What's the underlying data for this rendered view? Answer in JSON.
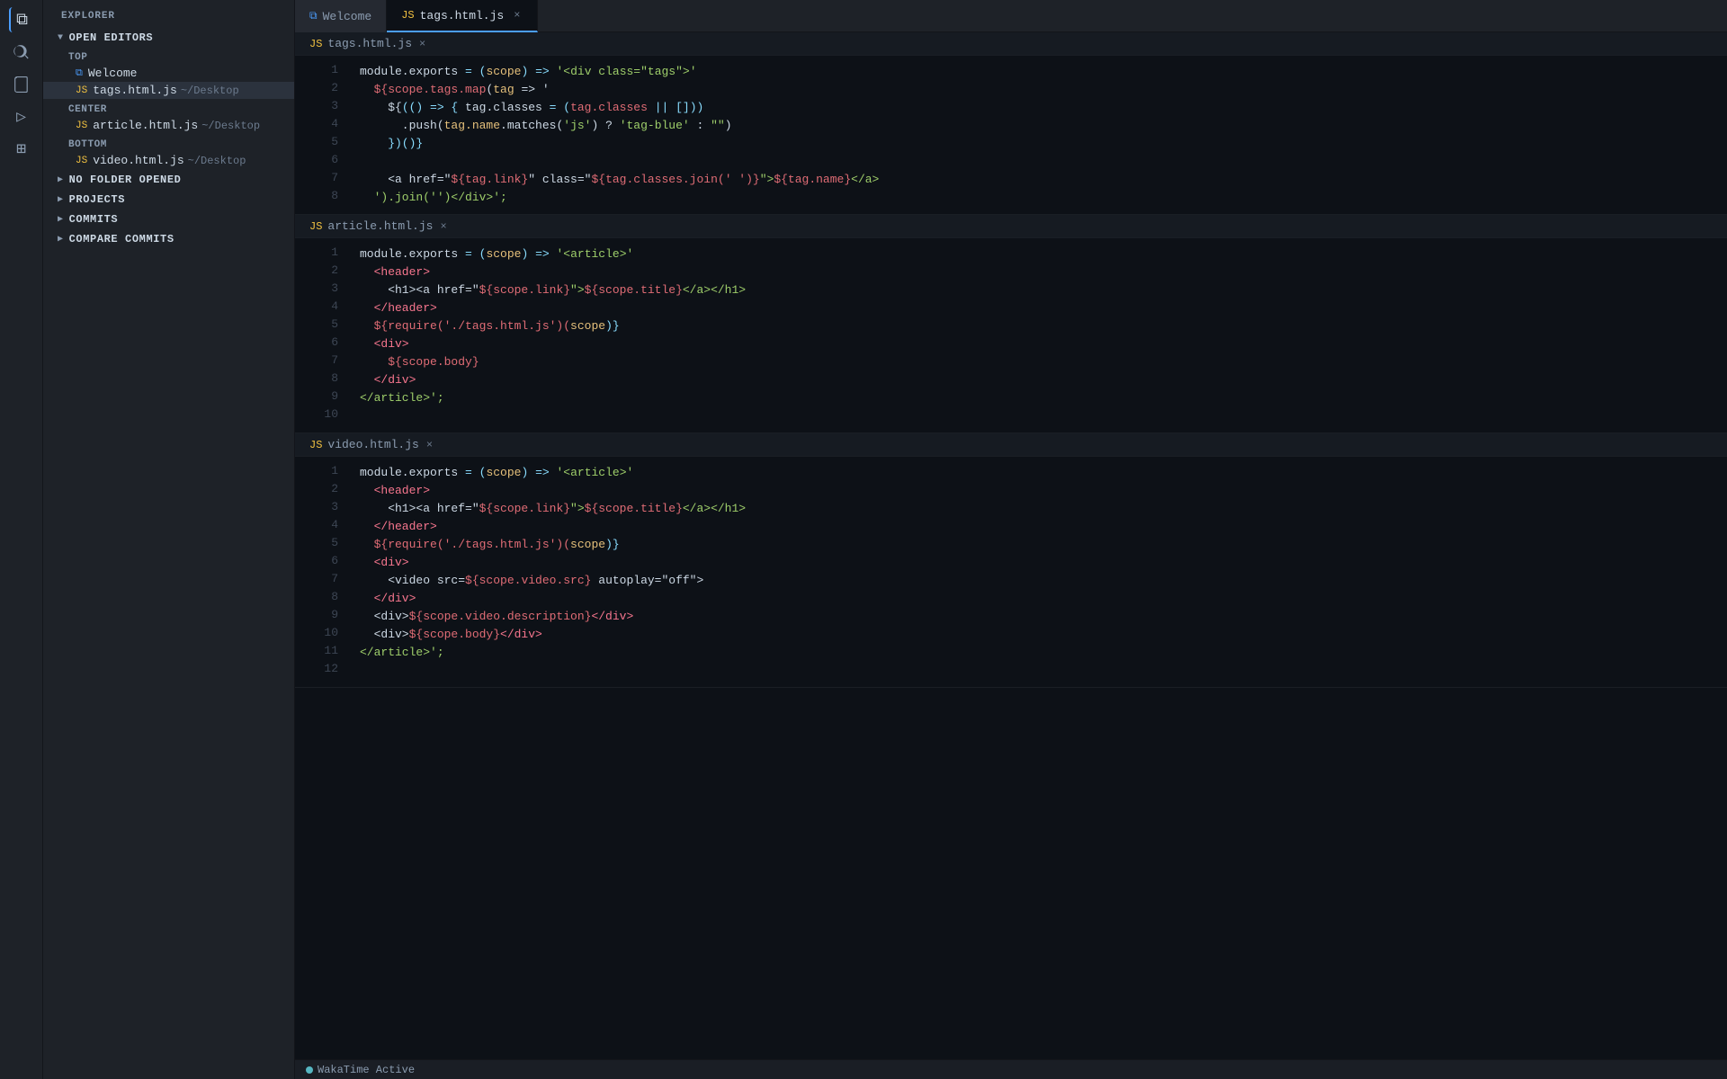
{
  "activityBar": {
    "icons": [
      {
        "name": "files-icon",
        "symbol": "⧉",
        "active": true
      },
      {
        "name": "search-icon",
        "symbol": "🔍"
      },
      {
        "name": "source-control-icon",
        "symbol": "⎇"
      },
      {
        "name": "debug-icon",
        "symbol": "▷"
      },
      {
        "name": "extensions-icon",
        "symbol": "⊞"
      }
    ]
  },
  "sidebar": {
    "title": "EXPLORER",
    "sections": [
      {
        "id": "open-editors",
        "label": "OPEN EDITORS",
        "expanded": true,
        "groups": [
          {
            "label": "TOP",
            "files": [
              {
                "icon": "vscode",
                "color": "blue",
                "name": "Welcome",
                "path": ""
              },
              {
                "icon": "js",
                "color": "js",
                "name": "tags.html.js",
                "path": "~/Desktop",
                "active": true
              }
            ]
          },
          {
            "label": "CENTER",
            "files": [
              {
                "icon": "js",
                "color": "js",
                "name": "article.html.js",
                "path": "~/Desktop"
              }
            ]
          },
          {
            "label": "BOTTOM",
            "files": [
              {
                "icon": "js",
                "color": "js",
                "name": "video.html.js",
                "path": "~/Desktop"
              }
            ]
          }
        ]
      },
      {
        "id": "no-folder",
        "label": "NO FOLDER OPENED",
        "expanded": false
      },
      {
        "id": "projects",
        "label": "PROJECTS",
        "expanded": false
      },
      {
        "id": "commits",
        "label": "COMMITS",
        "expanded": false
      },
      {
        "id": "compare-commits",
        "label": "COMPARE COMMiTS",
        "expanded": false
      }
    ]
  },
  "tabs": [
    {
      "label": "Welcome",
      "icon": "vscode",
      "active": false,
      "closable": false
    },
    {
      "label": "tags.html.js",
      "icon": "js",
      "active": true,
      "closable": true
    }
  ],
  "editors": [
    {
      "id": "tags-html-js",
      "filename": "tags.html.js",
      "icon": "JS",
      "lines": [
        {
          "num": 1,
          "tokens": [
            {
              "t": "plain",
              "v": "module.exports = "
            },
            {
              "t": "punc",
              "v": "("
            },
            {
              "t": "param",
              "v": "scope"
            },
            {
              "t": "punc",
              "v": ")"
            },
            {
              "t": "plain",
              "v": " "
            },
            {
              "t": "punc",
              "v": "=>"
            },
            {
              "t": "str",
              "v": " '<div class=\"tags\">'"
            }
          ]
        },
        {
          "num": 2,
          "tokens": [
            {
              "t": "tmpl",
              "v": "  ${scope.tags.map"
            },
            {
              "t": "plain",
              "v": "("
            },
            {
              "t": "param",
              "v": "tag"
            },
            {
              "t": "plain",
              "v": " => '"
            }
          ]
        },
        {
          "num": 3,
          "tokens": [
            {
              "t": "plain",
              "v": "    ${"
            },
            {
              "t": "punc",
              "v": "(() => {"
            },
            {
              "t": "plain",
              "v": " tag.classes = "
            },
            {
              "t": "punc",
              "v": "("
            },
            {
              "t": "red",
              "v": "tag.classes"
            },
            {
              "t": "punc",
              "v": " || "
            },
            {
              "t": "punc",
              "v": "[]"
            },
            {
              "t": "punc",
              "v": ")"
            },
            {
              "t": "punc",
              "v": ")"
            }
          ]
        },
        {
          "num": 4,
          "tokens": [
            {
              "t": "plain",
              "v": "      .push("
            },
            {
              "t": "param",
              "v": "tag.name"
            },
            {
              "t": "plain",
              "v": ".matches("
            },
            {
              "t": "str",
              "v": "'js'"
            },
            {
              "t": "plain",
              "v": ") ? "
            },
            {
              "t": "str",
              "v": "'tag-blue'"
            },
            {
              "t": "plain",
              "v": " : "
            },
            {
              "t": "str",
              "v": "\"\""
            }
          ]
        },
        {
          "num": 5,
          "tokens": [
            {
              "t": "punc",
              "v": "    })()"
            },
            {
              "t": "punc",
              "v": "}"
            }
          ]
        },
        {
          "num": 6,
          "tokens": []
        },
        {
          "num": 7,
          "tokens": [
            {
              "t": "plain",
              "v": "    <a href=\""
            },
            {
              "t": "tmpl",
              "v": "${tag.link}"
            },
            {
              "t": "plain",
              "v": "\" class=\""
            },
            {
              "t": "tmpl",
              "v": "${tag.classes.join(' ')}"
            },
            {
              "t": "str",
              "v": "\">"
            },
            {
              "t": "tmpl",
              "v": "${tag.name}"
            },
            {
              "t": "str",
              "v": "</a>"
            }
          ]
        },
        {
          "num": 8,
          "tokens": [
            {
              "t": "str",
              "v": "  ').join('')</div>';"
            }
          ]
        }
      ]
    },
    {
      "id": "article-html-js",
      "filename": "article.html.js",
      "icon": "JS",
      "lines": [
        {
          "num": 1,
          "tokens": [
            {
              "t": "plain",
              "v": "module.exports = "
            },
            {
              "t": "punc",
              "v": "("
            },
            {
              "t": "param",
              "v": "scope"
            },
            {
              "t": "punc",
              "v": ")"
            },
            {
              "t": "plain",
              "v": " "
            },
            {
              "t": "punc",
              "v": "=>"
            },
            {
              "t": "str",
              "v": " '<article>'"
            }
          ]
        },
        {
          "num": 2,
          "tokens": [
            {
              "t": "tag-c",
              "v": "  <header>"
            }
          ]
        },
        {
          "num": 3,
          "tokens": [
            {
              "t": "plain",
              "v": "    <h1><a href=\""
            },
            {
              "t": "tmpl",
              "v": "${scope.link}"
            },
            {
              "t": "str",
              "v": "\">"
            },
            {
              "t": "tmpl",
              "v": "${scope.title}"
            },
            {
              "t": "str",
              "v": "</a></h1>"
            }
          ]
        },
        {
          "num": 4,
          "tokens": [
            {
              "t": "tag-c",
              "v": "  </header>"
            }
          ]
        },
        {
          "num": 5,
          "tokens": [
            {
              "t": "tmpl",
              "v": "  ${require('./tags.html.js')"
            },
            {
              "t": "punc",
              "v": "("
            },
            {
              "t": "param",
              "v": "scope"
            },
            {
              "t": "punc",
              "v": ")"
            },
            {
              "t": "punc",
              "v": "}"
            }
          ]
        },
        {
          "num": 6,
          "tokens": [
            {
              "t": "tag-c",
              "v": "  <div>"
            }
          ]
        },
        {
          "num": 7,
          "tokens": [
            {
              "t": "tmpl",
              "v": "    ${scope.body}"
            }
          ]
        },
        {
          "num": 8,
          "tokens": [
            {
              "t": "tag-c",
              "v": "  </div>"
            }
          ]
        },
        {
          "num": 9,
          "tokens": [
            {
              "t": "str",
              "v": "</article>';"
            }
          ]
        },
        {
          "num": 10,
          "tokens": []
        }
      ]
    },
    {
      "id": "video-html-js",
      "filename": "video.html.js",
      "icon": "JS",
      "lines": [
        {
          "num": 1,
          "tokens": [
            {
              "t": "plain",
              "v": "module.exports = "
            },
            {
              "t": "punc",
              "v": "("
            },
            {
              "t": "param",
              "v": "scope"
            },
            {
              "t": "punc",
              "v": ")"
            },
            {
              "t": "plain",
              "v": " "
            },
            {
              "t": "punc",
              "v": "=>"
            },
            {
              "t": "str",
              "v": " '<article>'"
            }
          ]
        },
        {
          "num": 2,
          "tokens": [
            {
              "t": "tag-c",
              "v": "  <header>"
            }
          ]
        },
        {
          "num": 3,
          "tokens": [
            {
              "t": "plain",
              "v": "    <h1><a href=\""
            },
            {
              "t": "tmpl",
              "v": "${scope.link}"
            },
            {
              "t": "str",
              "v": "\">"
            },
            {
              "t": "tmpl",
              "v": "${scope.title}"
            },
            {
              "t": "str",
              "v": "</a></h1>"
            }
          ]
        },
        {
          "num": 4,
          "tokens": [
            {
              "t": "tag-c",
              "v": "  </header>"
            }
          ]
        },
        {
          "num": 5,
          "tokens": [
            {
              "t": "tmpl",
              "v": "  ${require('./tags.html.js')"
            },
            {
              "t": "punc",
              "v": "("
            },
            {
              "t": "param",
              "v": "scope"
            },
            {
              "t": "punc",
              "v": ")"
            },
            {
              "t": "punc",
              "v": "}"
            }
          ]
        },
        {
          "num": 6,
          "tokens": [
            {
              "t": "tag-c",
              "v": "  <div>"
            }
          ]
        },
        {
          "num": 7,
          "tokens": [
            {
              "t": "plain",
              "v": "    <video src="
            },
            {
              "t": "tmpl",
              "v": "${scope.video.src}"
            },
            {
              "t": "plain",
              "v": " autoplay=\"off\">"
            }
          ]
        },
        {
          "num": 8,
          "tokens": [
            {
              "t": "tag-c",
              "v": "  </div>"
            }
          ]
        },
        {
          "num": 9,
          "tokens": [
            {
              "t": "plain",
              "v": "  <div>"
            },
            {
              "t": "tmpl",
              "v": "${scope.video.description}"
            },
            {
              "t": "tag-c",
              "v": "</div>"
            }
          ]
        },
        {
          "num": 10,
          "tokens": [
            {
              "t": "plain",
              "v": "  <div>"
            },
            {
              "t": "tmpl",
              "v": "${scope.body}"
            },
            {
              "t": "tag-c",
              "v": "</div>"
            }
          ]
        },
        {
          "num": 11,
          "tokens": [
            {
              "t": "str",
              "v": "</article>';"
            }
          ]
        },
        {
          "num": 12,
          "tokens": []
        }
      ]
    }
  ],
  "statusBar": {
    "indicator": "⚡",
    "wakatime": "WakaTime Active"
  }
}
